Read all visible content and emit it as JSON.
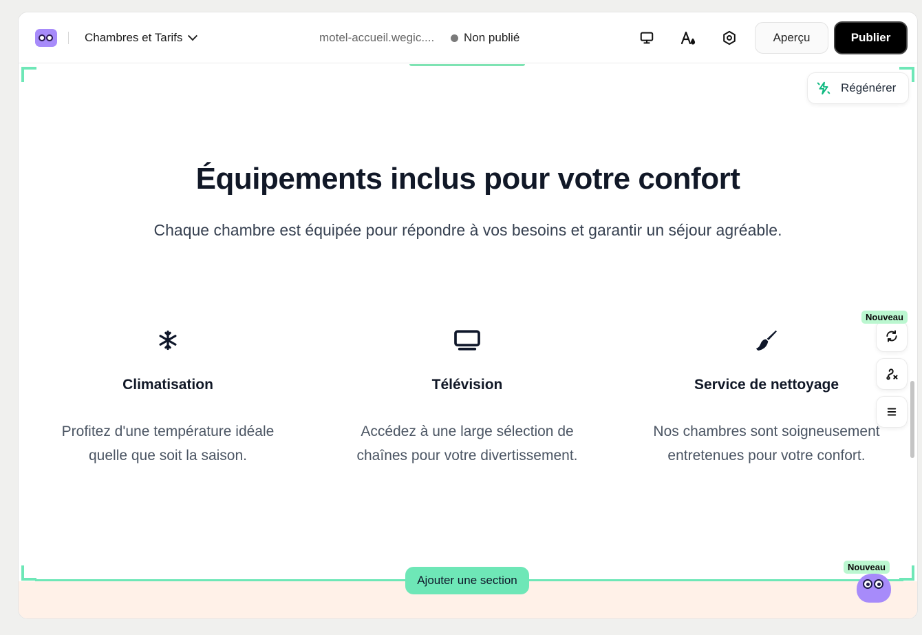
{
  "topbar": {
    "page_selector": "Chambres et Tarifs",
    "url": "motel-accueil.wegic....",
    "status": "Non publié",
    "icons": [
      "monitor-icon",
      "text-color-icon",
      "settings-icon"
    ],
    "preview_label": "Aperçu",
    "publish_label": "Publier"
  },
  "canvas": {
    "regen_label": "Régénérer",
    "headline": "Équipements inclus pour votre confort",
    "subhead": "Chaque chambre est équipée pour répondre à vos besoins et garantir un séjour agréable.",
    "features": [
      {
        "icon": "snowflake-icon",
        "title": "Climatisation",
        "desc_line1": "Profitez d'une température idéale",
        "desc_line2": "quelle que soit la saison."
      },
      {
        "icon": "tv-icon",
        "title": "Télévision",
        "desc_line1": "Accédez à une large sélection de",
        "desc_line2": "chaînes pour votre divertissement."
      },
      {
        "icon": "broom-icon",
        "title": "Service de nettoyage",
        "desc_line1": "Nos chambres sont soigneusement",
        "desc_line2": "entretenues pour votre confort."
      }
    ],
    "add_section_label": "Ajouter une section"
  },
  "side_tools": {
    "badge_top": "Nouveau",
    "icons": [
      "refresh-icon",
      "path-edit-icon",
      "menu-icon"
    ],
    "badge_bottom": "Nouveau"
  },
  "colors": {
    "accent_green": "#6ee7b7",
    "brand_purple": "#a78bfa",
    "publish_bg": "#000000",
    "next_section_bg": "#fff1e8"
  }
}
